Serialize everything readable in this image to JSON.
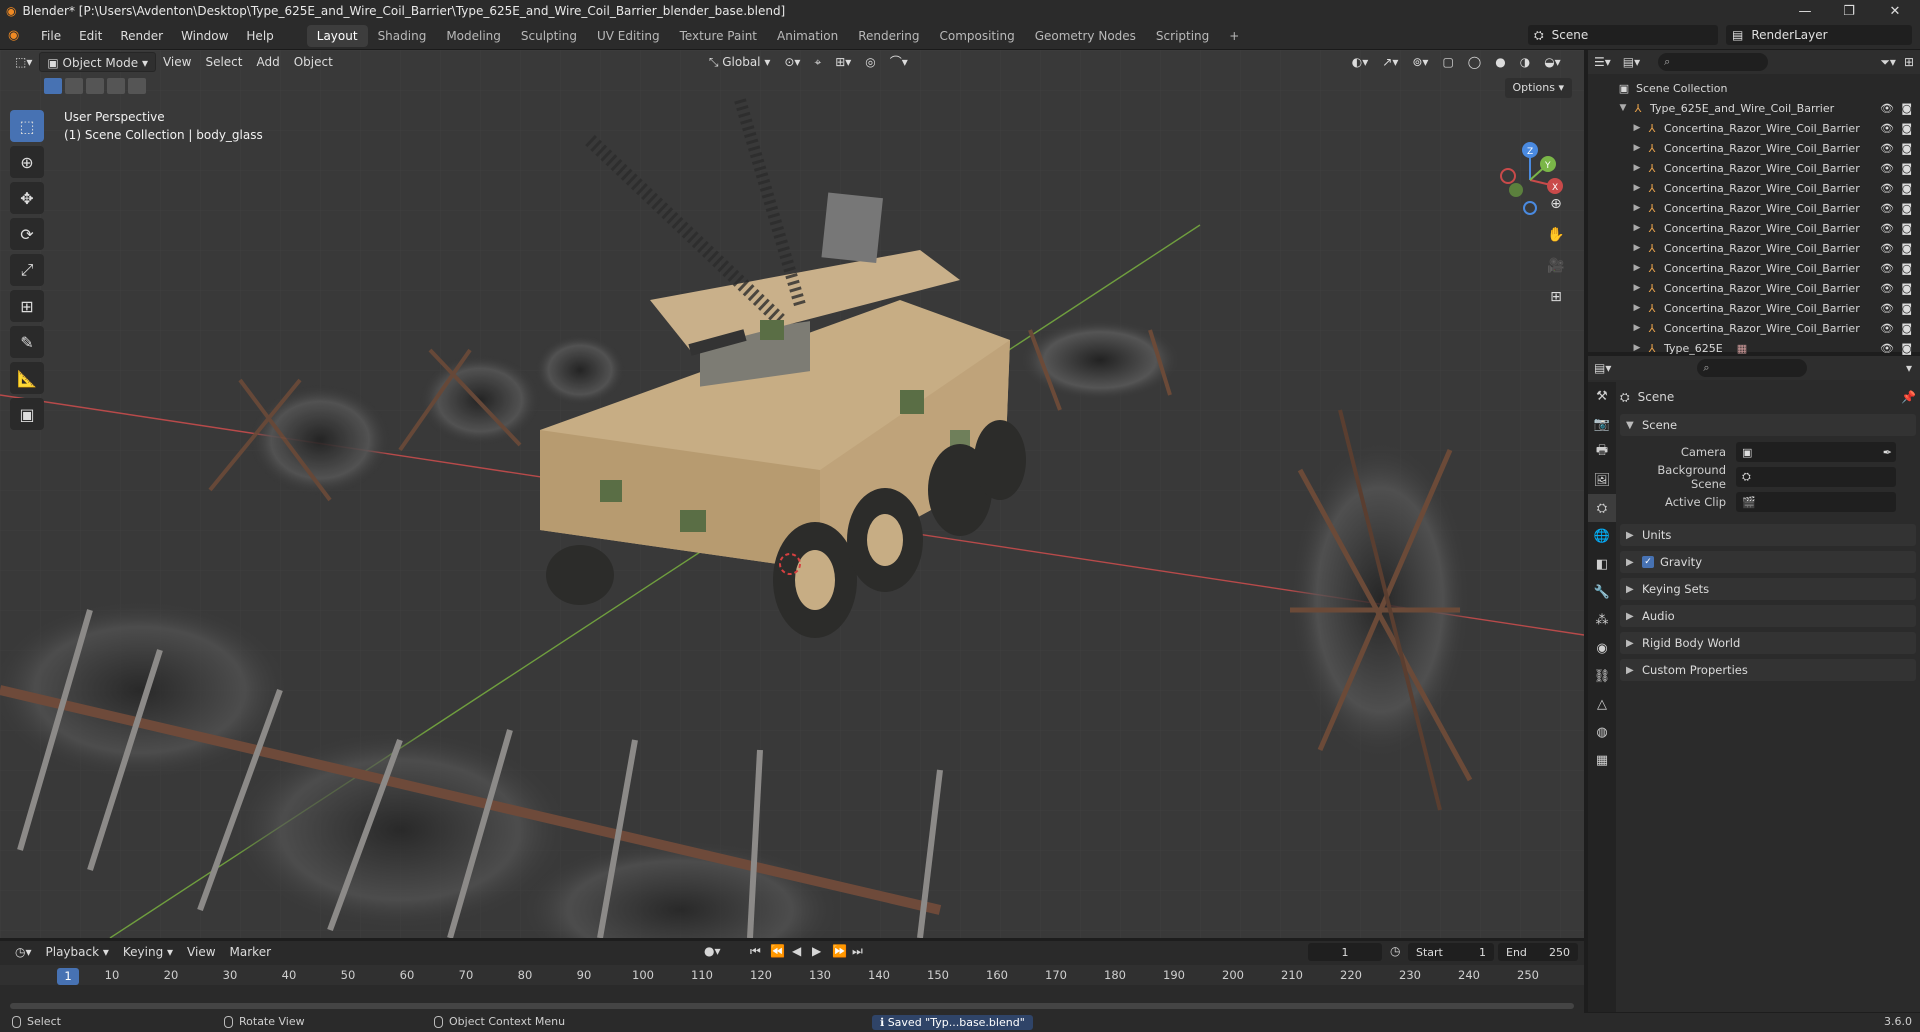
{
  "window": {
    "title": "Blender* [P:\\Users\\Avdenton\\Desktop\\Type_625E_and_Wire_Coil_Barrier\\Type_625E_and_Wire_Coil_Barrier_blender_base.blend]"
  },
  "menu": [
    "File",
    "Edit",
    "Render",
    "Window",
    "Help"
  ],
  "workspaces": [
    "Layout",
    "Shading",
    "Modeling",
    "Sculpting",
    "UV Editing",
    "Texture Paint",
    "Animation",
    "Rendering",
    "Compositing",
    "Geometry Nodes",
    "Scripting"
  ],
  "active_workspace": "Layout",
  "scene_selector": "Scene",
  "view_layer": "RenderLayer",
  "viewport": {
    "mode": "Object Mode",
    "menus": [
      "View",
      "Select",
      "Add",
      "Object"
    ],
    "orientation": "Global",
    "options": "Options",
    "overlay_line1": "User Perspective",
    "overlay_line2": "(1) Scene Collection | body_glass"
  },
  "outliner": {
    "root": "Scene Collection",
    "collection": "Type_625E_and_Wire_Coil_Barrier",
    "items": [
      "Concertina_Razor_Wire_Coil_Barrier",
      "Concertina_Razor_Wire_Coil_Barrier",
      "Concertina_Razor_Wire_Coil_Barrier",
      "Concertina_Razor_Wire_Coil_Barrier",
      "Concertina_Razor_Wire_Coil_Barrier",
      "Concertina_Razor_Wire_Coil_Barrier",
      "Concertina_Razor_Wire_Coil_Barrier",
      "Concertina_Razor_Wire_Coil_Barrier",
      "Concertina_Razor_Wire_Coil_Barrier",
      "Concertina_Razor_Wire_Coil_Barrier",
      "Concertina_Razor_Wire_Coil_Barrier",
      "Type_625E"
    ]
  },
  "properties": {
    "context": "Scene",
    "panel": "Scene",
    "fields": [
      {
        "label": "Camera",
        "value": ""
      },
      {
        "label": "Background Scene",
        "value": ""
      },
      {
        "label": "Active Clip",
        "value": ""
      }
    ],
    "sections": [
      "Units",
      "Gravity",
      "Keying Sets",
      "Audio",
      "Rigid Body World",
      "Custom Properties"
    ],
    "gravity_enabled": true
  },
  "timeline": {
    "menus": [
      "Playback",
      "Keying",
      "View",
      "Marker"
    ],
    "current_frame": "1",
    "start_label": "Start",
    "start": "1",
    "end_label": "End",
    "end": "250",
    "ticks": [
      "10",
      "20",
      "30",
      "40",
      "50",
      "60",
      "70",
      "80",
      "90",
      "100",
      "110",
      "120",
      "130",
      "140",
      "150",
      "160",
      "170",
      "180",
      "190",
      "200",
      "210",
      "220",
      "230",
      "240",
      "250"
    ]
  },
  "statusbar": {
    "select": "Select",
    "rotate": "Rotate View",
    "context_menu": "Object Context Menu",
    "saved": "Saved \"Typ...base.blend\"",
    "version": "3.6.0"
  },
  "colors": {
    "accent": "#4772b3",
    "x_axis": "#c94a4a",
    "y_axis": "#7ab648",
    "z_axis": "#4a8ae0"
  }
}
